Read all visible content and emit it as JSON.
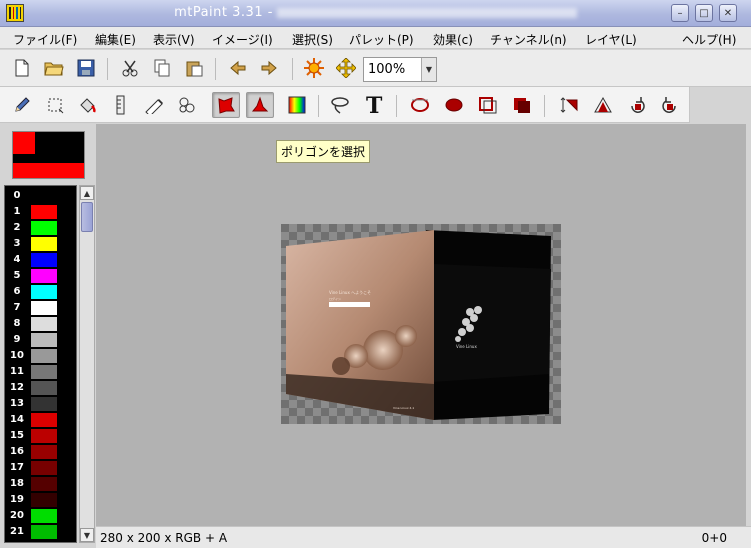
{
  "window": {
    "title": "mtPaint 3.31 -",
    "controls": {
      "minimize": "–",
      "maximize": "□",
      "close": "✕"
    }
  },
  "menu": [
    "ファイル(F)",
    "編集(E)",
    "表示(V)",
    "イメージ(I)",
    "選択(S)",
    "パレット(P)",
    "効果(c)",
    "チャンネル(n)",
    "レイヤ(L)",
    "ヘルプ(H)"
  ],
  "toolbar1": {
    "icons": [
      "new-file-icon",
      "open-folder-icon",
      "save-icon",
      "cut-icon",
      "copy-icon",
      "paste-icon",
      "undo-arrow-icon",
      "redo-arrow-icon",
      "sun-icon",
      "pan-arrows-icon"
    ],
    "zoom_value": "100%"
  },
  "toolbar2": {
    "icons": [
      "pencil-icon",
      "select-rectangle-icon",
      "fill-bucket-icon",
      "ruler-icon",
      "smudge-icon",
      "clone-icon",
      "polygon-select-icon",
      "polygon-select-active-icon",
      "gradient-icon",
      "lasso-icon",
      "text-icon",
      "ellipse-icon",
      "filled-ellipse-icon",
      "outline-select-icon",
      "fill-select-icon",
      "flip-vertical-icon",
      "flip-horizontal-icon",
      "rotate-ccw-icon",
      "rotate-cw-icon"
    ],
    "pressed_index": 7
  },
  "tooltip": "ポリゴンを選択",
  "palette": [
    {
      "index": "0",
      "color": "#000000"
    },
    {
      "index": "1",
      "color": "#ff0000"
    },
    {
      "index": "2",
      "color": "#00ff00"
    },
    {
      "index": "3",
      "color": "#ffff00"
    },
    {
      "index": "4",
      "color": "#0000ff"
    },
    {
      "index": "5",
      "color": "#ff00ff"
    },
    {
      "index": "6",
      "color": "#00ffff"
    },
    {
      "index": "7",
      "color": "#ffffff"
    },
    {
      "index": "8",
      "color": "#dddddd"
    },
    {
      "index": "9",
      "color": "#bbbbbb"
    },
    {
      "index": "10",
      "color": "#999999"
    },
    {
      "index": "11",
      "color": "#777777"
    },
    {
      "index": "12",
      "color": "#555555"
    },
    {
      "index": "13",
      "color": "#333333"
    },
    {
      "index": "14",
      "color": "#dd0000"
    },
    {
      "index": "15",
      "color": "#bb0000"
    },
    {
      "index": "16",
      "color": "#990000"
    },
    {
      "index": "17",
      "color": "#770000"
    },
    {
      "index": "18",
      "color": "#550000"
    },
    {
      "index": "19",
      "color": "#330000"
    },
    {
      "index": "20",
      "color": "#00dd00"
    },
    {
      "index": "21",
      "color": "#00bb00"
    }
  ],
  "image_text": {
    "login_title": "Vine Linux へようこそ",
    "login_label": "ログイン",
    "logo_text": "Vine Linux",
    "footer": "Vine Linux 4.1"
  },
  "status": {
    "info": "280 x 200 x RGB + A",
    "coords": "0+0"
  }
}
